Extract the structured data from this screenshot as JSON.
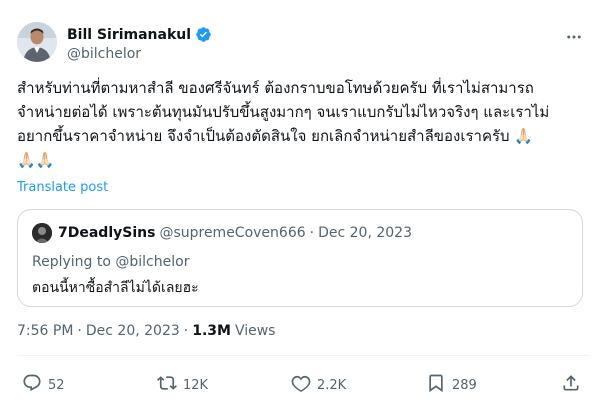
{
  "author": {
    "display_name": "Bill Sirimanakul",
    "handle": "@bilchelor"
  },
  "tweet": {
    "text": "สำหรับท่านที่ตามหาสำลี ของศรีจันทร์ ต้องกราบขอโทษด้วยครับ ที่เราไม่สามารถ\nจำหน่ายต่อได้ เพราะต้นทุนมันปรับขึ้นสูงมากๆ จนเราแบกรับไม่ไหวจริงๆ และเราไม่\nอยากขึ้นราคาจำหน่าย จึงจำเป็นต้องตัดสินใจ ยกเลิกจำหน่ายสำลีของเราครับ 🙏🏻\n🙏🏻🙏🏻",
    "translate_label": "Translate post",
    "time": "7:56 PM",
    "separator": "·",
    "date": "Dec 20, 2023",
    "views_count": "1.3M",
    "views_label": "Views"
  },
  "quote": {
    "display_name": "7DeadlySins",
    "handle": "@supremeCoven666",
    "separator": "·",
    "date": "Dec 20, 2023",
    "replying_prefix": "Replying to ",
    "replying_handle": "@bilchelor",
    "text": "ตอนนี้หาซื้อสำลีไม่ได้เลยฮะ"
  },
  "actions": {
    "replies": "52",
    "reposts": "12K",
    "likes": "2.2K",
    "bookmarks": "289"
  },
  "colors": {
    "accent": "#1d9bf0",
    "text": "#0f1419",
    "muted": "#536471",
    "border": "#cfd9de"
  },
  "icons": [
    "verified-badge-icon",
    "more-icon",
    "reply-icon",
    "repost-icon",
    "like-icon",
    "bookmark-icon",
    "share-icon"
  ]
}
